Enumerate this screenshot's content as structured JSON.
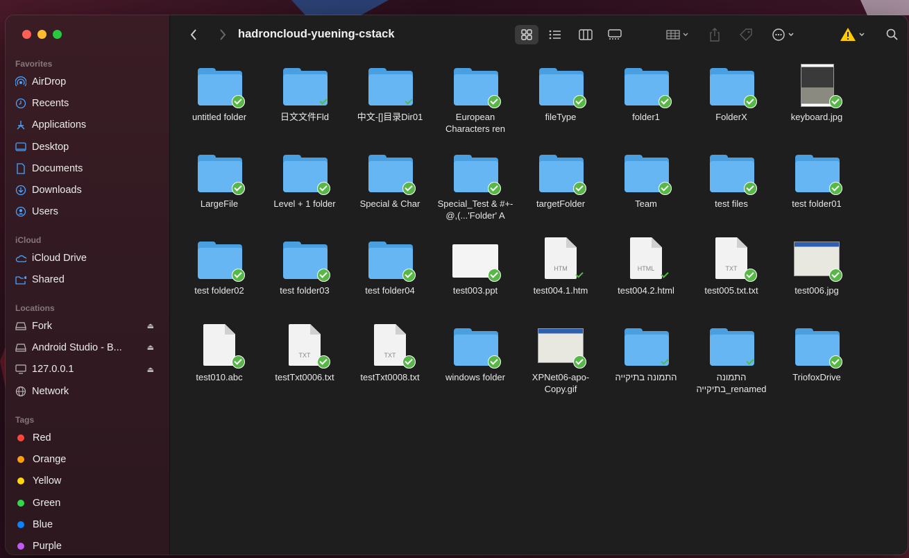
{
  "window": {
    "title": "hadroncloud-yuening-cstack"
  },
  "sidebar": {
    "favorites_heading": "Favorites",
    "favorites": [
      {
        "label": "AirDrop",
        "icon": "airdrop-icon"
      },
      {
        "label": "Recents",
        "icon": "clock-icon"
      },
      {
        "label": "Applications",
        "icon": "applications-icon"
      },
      {
        "label": "Desktop",
        "icon": "desktop-icon"
      },
      {
        "label": "Documents",
        "icon": "document-icon"
      },
      {
        "label": "Downloads",
        "icon": "download-icon"
      },
      {
        "label": "Users",
        "icon": "user-icon"
      }
    ],
    "icloud_heading": "iCloud",
    "icloud": [
      {
        "label": "iCloud Drive",
        "icon": "cloud-icon"
      },
      {
        "label": "Shared",
        "icon": "shared-folder-icon"
      }
    ],
    "locations_heading": "Locations",
    "locations": [
      {
        "label": "Fork",
        "icon": "drive-icon",
        "eject": true
      },
      {
        "label": "Android Studio - B...",
        "icon": "drive-icon",
        "eject": true
      },
      {
        "label": "127.0.0.1",
        "icon": "monitor-icon",
        "eject": true
      },
      {
        "label": "Network",
        "icon": "network-icon",
        "eject": false
      }
    ],
    "tags_heading": "Tags",
    "tags": [
      {
        "label": "Red",
        "color": "#ff453a"
      },
      {
        "label": "Orange",
        "color": "#ff9f0a"
      },
      {
        "label": "Yellow",
        "color": "#ffd60a"
      },
      {
        "label": "Green",
        "color": "#32d74b"
      },
      {
        "label": "Blue",
        "color": "#0a84ff"
      },
      {
        "label": "Purple",
        "color": "#bf5af2"
      }
    ]
  },
  "files": [
    {
      "label": "untitled folder",
      "kind": "folder",
      "sync": "big"
    },
    {
      "label": "日文文件Fld",
      "kind": "folder",
      "sync": "small"
    },
    {
      "label": "中文-[]目录Dir01",
      "kind": "folder",
      "sync": "small"
    },
    {
      "label": "European Characters ren",
      "kind": "folder",
      "sync": "big"
    },
    {
      "label": "fileType",
      "kind": "folder",
      "sync": "big"
    },
    {
      "label": "folder1",
      "kind": "folder",
      "sync": "big"
    },
    {
      "label": "FolderX",
      "kind": "folder",
      "sync": "big"
    },
    {
      "label": "keyboard.jpg",
      "kind": "photo",
      "sync": "big"
    },
    {
      "label": "LargeFile",
      "kind": "folder",
      "sync": "big"
    },
    {
      "label": "Level + 1 folder",
      "kind": "folder",
      "sync": "big"
    },
    {
      "label": "Special & Char",
      "kind": "folder",
      "sync": "big"
    },
    {
      "label": "Special_Test & #+-@,(...'Folder' A",
      "kind": "folder",
      "sync": "big"
    },
    {
      "label": "targetFolder",
      "kind": "folder",
      "sync": "big"
    },
    {
      "label": "Team",
      "kind": "folder",
      "sync": "big"
    },
    {
      "label": "test files",
      "kind": "folder",
      "sync": "big"
    },
    {
      "label": "test folder01",
      "kind": "folder",
      "sync": "big"
    },
    {
      "label": "test folder02",
      "kind": "folder",
      "sync": "big"
    },
    {
      "label": "test folder03",
      "kind": "folder",
      "sync": "big"
    },
    {
      "label": "test folder04",
      "kind": "folder",
      "sync": "big"
    },
    {
      "label": "test003.ppt",
      "kind": "slide",
      "sync": "big"
    },
    {
      "label": "test004.1.htm",
      "kind": "doc",
      "ext": "HTM",
      "sync": "small"
    },
    {
      "label": "test004.2.html",
      "kind": "doc",
      "ext": "HTML",
      "sync": "small"
    },
    {
      "label": "test005.txt.txt",
      "kind": "doc",
      "ext": "TXT",
      "sync": "big"
    },
    {
      "label": "test006.jpg",
      "kind": "screenshot",
      "sync": "big"
    },
    {
      "label": "test010.abc",
      "kind": "doc",
      "ext": "",
      "sync": "big"
    },
    {
      "label": "testTxt0006.txt",
      "kind": "doc",
      "ext": "TXT",
      "sync": "big"
    },
    {
      "label": "testTxt0008.txt",
      "kind": "doc",
      "ext": "TXT",
      "sync": "big"
    },
    {
      "label": "windows folder",
      "kind": "folder",
      "sync": "big"
    },
    {
      "label": "XPNet06-apo-Copy.gif",
      "kind": "screenshot",
      "sync": "big"
    },
    {
      "label": "התמונה בתיקייה",
      "kind": "folder",
      "sync": "small"
    },
    {
      "label": "התמונה בתיקייה_renamed",
      "kind": "folder",
      "sync": "small"
    },
    {
      "label": "TriofoxDrive",
      "kind": "folder",
      "sync": "big"
    }
  ],
  "toolbar": {
    "back": "chevron-left-icon",
    "forward": "chevron-right-icon",
    "views": [
      "icon-view-icon",
      "list-view-icon",
      "column-view-icon",
      "gallery-view-icon"
    ],
    "actions": [
      "group-icon",
      "share-icon",
      "tag-icon",
      "more-icon",
      "warning-icon",
      "search-icon"
    ]
  }
}
